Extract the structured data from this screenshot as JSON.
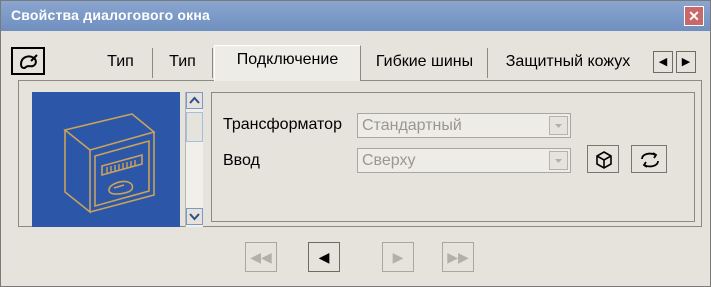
{
  "window": {
    "title": "Свойства диалогового окна",
    "close_glyph": "✕"
  },
  "tabs": [
    {
      "label": "Тип"
    },
    {
      "label": "Тип"
    },
    {
      "label": "Подключение"
    },
    {
      "label": "Гибкие шины"
    },
    {
      "label": "Защитный кожух"
    }
  ],
  "tab_scroll": {
    "left_glyph": "◀",
    "right_glyph": "▶"
  },
  "fields": {
    "transformer_label": "Трансформатор",
    "transformer_value": "Стандартный",
    "input_label": "Ввод",
    "input_value": "Сверху"
  },
  "nav": {
    "first": "◀◀",
    "prev": "◀",
    "next": "▶",
    "last": "▶▶"
  },
  "icons": {
    "tool": "paint-icon",
    "cube": "cube-icon",
    "refresh": "rotate-icon",
    "preview": "cabinet-icon"
  },
  "colors": {
    "title_bg": "#7b97c8",
    "preview_bg": "#2c56a8",
    "close_bg": "#c8686a"
  }
}
